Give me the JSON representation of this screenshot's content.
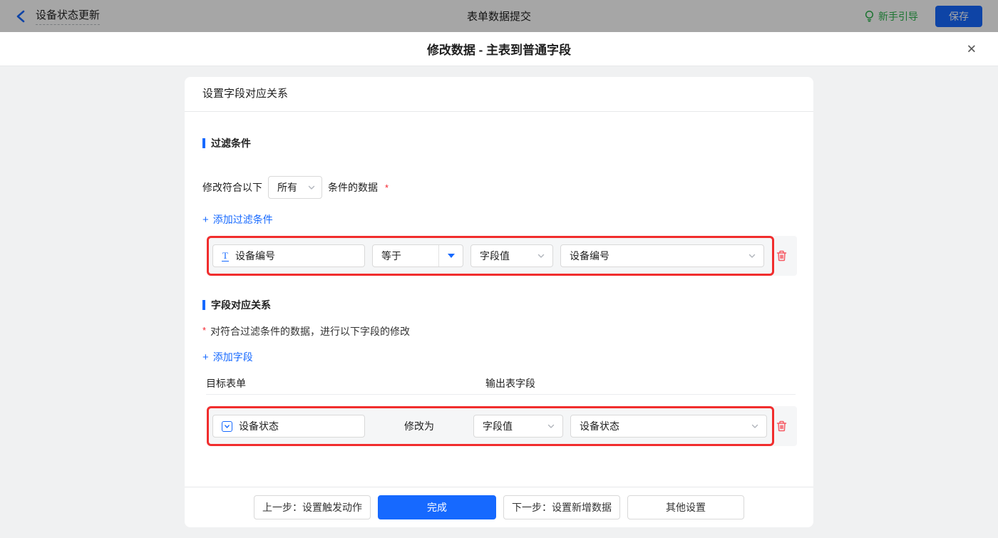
{
  "topbar": {
    "app_title": "设备状态更新",
    "center_title": "表单数据提交",
    "guide_label": "新手引导",
    "save_label": "保存"
  },
  "modal": {
    "title": "修改数据 - 主表到普通字段",
    "close_glyph": "✕"
  },
  "card": {
    "header": "设置字段对应关系",
    "filter_section": {
      "title": "过滤条件",
      "match_prefix": "修改符合以下",
      "match_select_value": "所有",
      "match_suffix": "条件的数据",
      "required_mark": "*",
      "add_plus": "+",
      "add_label": "添加过滤条件",
      "row": {
        "field_label": "设备编号",
        "field_icon": "text-field",
        "operator_value": "等于",
        "value_type": "字段值",
        "value_field": "设备编号"
      }
    },
    "mapping_section": {
      "title": "字段对应关系",
      "required_mark": "*",
      "description": "对符合过滤条件的数据，进行以下字段的修改",
      "add_plus": "+",
      "add_label": "添加字段",
      "col_target": "目标表单",
      "col_output": "输出表字段",
      "row": {
        "field_label": "设备状态",
        "field_icon": "select-field",
        "action_label": "修改为",
        "value_type": "字段值",
        "value_field": "设备状态"
      }
    },
    "footer": {
      "prev_label": "上一步：设置触发动作",
      "done_label": "完成",
      "next_label": "下一步：设置新增数据",
      "other_label": "其他设置"
    }
  },
  "colors": {
    "primary_blue": "#1669ff",
    "guide_green": "#2bb24c",
    "highlight_red": "#f12d2d",
    "danger_trash": "#f65b65",
    "required_red": "#f5222d"
  }
}
